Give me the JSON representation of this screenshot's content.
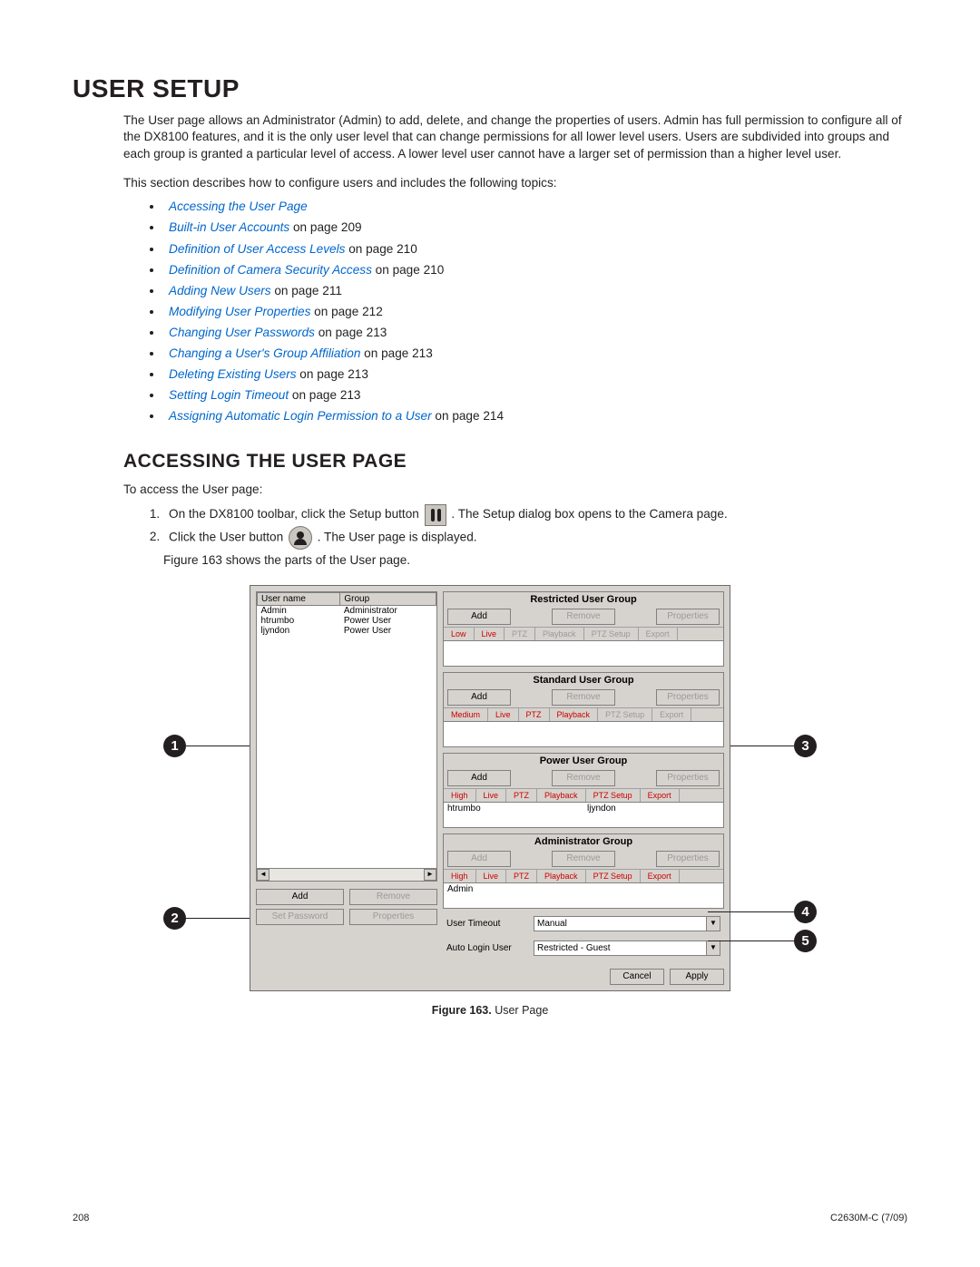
{
  "title": "USER SETUP",
  "intro": "The User page allows an Administrator (Admin) to add, delete, and change the properties of users. Admin has full permission to configure all of the DX8100 features, and it is the only user level that can change permissions for all lower level users. Users are subdivided into groups and each group is granted a particular level of access. A lower level user cannot have a larger set of permission than a higher level user.",
  "lead": "This section describes how to configure users and includes the following topics:",
  "toc": [
    {
      "link": "Accessing the User Page",
      "suffix": ""
    },
    {
      "link": "Built-in User Accounts",
      "suffix": " on page 209"
    },
    {
      "link": "Definition of User Access Levels",
      "suffix": " on page 210"
    },
    {
      "link": "Definition of Camera Security Access",
      "suffix": " on page 210"
    },
    {
      "link": "Adding New Users",
      "suffix": " on page 211"
    },
    {
      "link": "Modifying User Properties",
      "suffix": " on page 212"
    },
    {
      "link": "Changing User Passwords",
      "suffix": " on page 213"
    },
    {
      "link": "Changing a User's Group Affiliation",
      "suffix": " on page 213"
    },
    {
      "link": "Deleting Existing Users",
      "suffix": " on page 213"
    },
    {
      "link": "Setting Login Timeout",
      "suffix": " on page 213"
    },
    {
      "link": "Assigning Automatic Login Permission to a User",
      "suffix": " on page 214"
    }
  ],
  "sub": "ACCESSING THE USER PAGE",
  "access_intro": "To access the User page:",
  "step1a": "On the DX8100 toolbar, click the Setup button ",
  "step1b": ". The Setup dialog box opens to the Camera page.",
  "step2a": "Click the User button ",
  "step2b": ". The User page is displayed.",
  "figref": "Figure 163 shows the parts of the User page.",
  "dialog": {
    "userlist_head": [
      "User name",
      "Group"
    ],
    "userlist_rows": [
      [
        "Admin",
        "Administrator"
      ],
      [
        "htrumbo",
        "Power User"
      ],
      [
        "ljyndon",
        "Power User"
      ]
    ],
    "leftbtns": {
      "add": "Add",
      "remove": "Remove",
      "setpw": "Set Password",
      "props": "Properties"
    },
    "groups": [
      {
        "title": "Restricted User Group",
        "btns": [
          "Add",
          "Remove",
          "Properties"
        ],
        "btns_enabled": [
          true,
          false,
          false
        ],
        "tags": [
          "Low",
          "Live",
          "PTZ",
          "Playback",
          "PTZ Setup",
          "Export"
        ],
        "tags_style": [
          "red",
          "red",
          "dim",
          "dim",
          "dim",
          "dim"
        ],
        "list": []
      },
      {
        "title": "Standard User Group",
        "btns": [
          "Add",
          "Remove",
          "Properties"
        ],
        "btns_enabled": [
          true,
          false,
          false
        ],
        "tags": [
          "Medium",
          "Live",
          "PTZ",
          "Playback",
          "PTZ Setup",
          "Export"
        ],
        "tags_style": [
          "red",
          "red",
          "red",
          "red",
          "dim",
          "dim"
        ],
        "list": []
      },
      {
        "title": "Power User Group",
        "btns": [
          "Add",
          "Remove",
          "Properties"
        ],
        "btns_enabled": [
          true,
          false,
          false
        ],
        "tags": [
          "High",
          "Live",
          "PTZ",
          "Playback",
          "PTZ Setup",
          "Export"
        ],
        "tags_style": [
          "red",
          "red",
          "red",
          "red",
          "red",
          "red"
        ],
        "list": [
          "htrumbo",
          "ljyndon"
        ]
      },
      {
        "title": "Administrator Group",
        "btns": [
          "Add",
          "Remove",
          "Properties"
        ],
        "btns_enabled": [
          false,
          false,
          false
        ],
        "tags": [
          "High",
          "Live",
          "PTZ",
          "Playback",
          "PTZ Setup",
          "Export"
        ],
        "tags_style": [
          "red",
          "red",
          "red",
          "red",
          "red",
          "red"
        ],
        "list": [
          "Admin"
        ]
      }
    ],
    "timeout_label": "User Timeout",
    "timeout_value": "Manual",
    "autologin_label": "Auto Login User",
    "autologin_value": "Restricted - Guest",
    "cancel": "Cancel",
    "apply": "Apply"
  },
  "callouts": [
    "1",
    "2",
    "3",
    "4",
    "5"
  ],
  "caption_bold": "Figure 163.",
  "caption_rest": "  User Page",
  "footer_left": "208",
  "footer_right": "C2630M-C (7/09)"
}
